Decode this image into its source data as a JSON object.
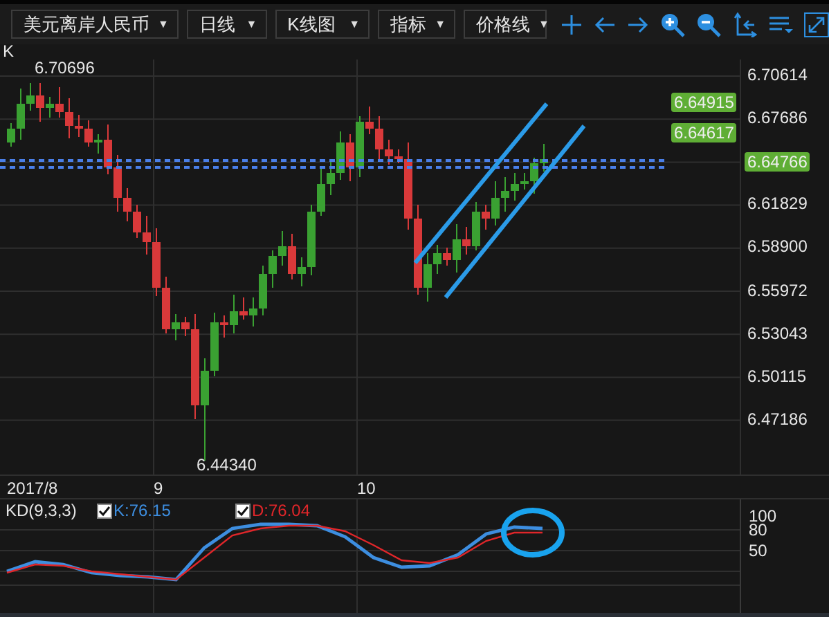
{
  "toolbar": {
    "dropdowns": [
      {
        "label": "美元离岸人民币",
        "caret": "▼"
      },
      {
        "label": "日线",
        "caret": "▼"
      },
      {
        "label": "K线图",
        "caret": "▼"
      },
      {
        "label": "指标",
        "caret": "▼"
      },
      {
        "label": "价格线",
        "caret": "▼"
      }
    ]
  },
  "price_chart": {
    "label": "K",
    "high_label": "6.70696",
    "low_label": "6.44340",
    "axis_labels": [
      "6.70614",
      "6.67686",
      "6.61829",
      "6.58900",
      "6.55972",
      "6.53043",
      "6.50115",
      "6.47186"
    ],
    "price_lines": [
      {
        "label": "6.64915"
      },
      {
        "label": "6.64617"
      }
    ],
    "current_price": "6.64766"
  },
  "date_labels": [
    "2017/8",
    "9",
    "10"
  ],
  "indicator": {
    "name": "KD(9,3,3)",
    "lines": [
      {
        "label": "K:76.15",
        "checked": true
      },
      {
        "label": "D:76.04",
        "checked": true
      }
    ],
    "chart_data": {
      "type": "line",
      "ylim": [
        -40,
        124
      ],
      "yticks": [
        50,
        80,
        100
      ],
      "series": [
        {
          "color": "#3d8ee0",
          "values": [
            20,
            34,
            30,
            18,
            14,
            12,
            8,
            54,
            82,
            88,
            88,
            86,
            70,
            40,
            26,
            28,
            44,
            74,
            84,
            82
          ]
        },
        {
          "color": "#e0262a",
          "values": [
            18,
            30,
            28,
            20,
            16,
            12,
            8,
            40,
            72,
            82,
            86,
            86,
            78,
            58,
            36,
            32,
            40,
            64,
            76,
            76
          ]
        }
      ]
    }
  }
}
